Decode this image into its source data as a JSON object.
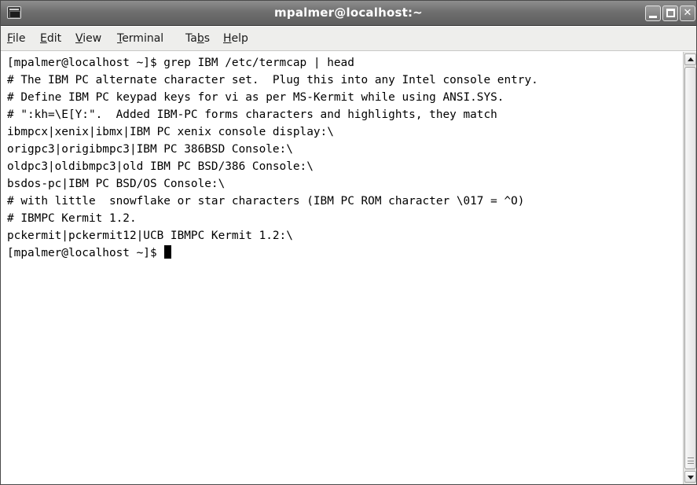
{
  "window": {
    "title": "mpalmer@localhost:~"
  },
  "menu": [
    {
      "mnemonic": "F",
      "rest": "ile"
    },
    {
      "mnemonic": "E",
      "rest": "dit"
    },
    {
      "mnemonic": "V",
      "rest": "iew"
    },
    {
      "mnemonic": "T",
      "rest": "erminal"
    },
    {
      "pre": "Ta",
      "mnemonic": "b",
      "rest": "s"
    },
    {
      "mnemonic": "H",
      "rest": "elp"
    }
  ],
  "terminal": {
    "lines": [
      "[mpalmer@localhost ~]$ grep IBM /etc/termcap | head",
      "# The IBM PC alternate character set.  Plug this into any Intel console entry.",
      "# Define IBM PC keypad keys for vi as per MS-Kermit while using ANSI.SYS.",
      "# \":kh=\\E[Y:\".  Added IBM-PC forms characters and highlights, they match",
      "ibmpcx|xenix|ibmx|IBM PC xenix console display:\\",
      "origpc3|origibmpc3|IBM PC 386BSD Console:\\",
      "oldpc3|oldibmpc3|old IBM PC BSD/386 Console:\\",
      "bsdos-pc|IBM PC BSD/OS Console:\\",
      "# with little  snowflake or star characters (IBM PC ROM character \\017 = ^O)",
      "# IBMPC Kermit 1.2.",
      "pckermit|pckermit12|UCB IBMPC Kermit 1.2:\\"
    ],
    "prompt": "[mpalmer@localhost ~]$ "
  },
  "icons": {
    "window_icon": "terminal-app-icon",
    "minimize": "minimize-icon",
    "maximize": "maximize-icon",
    "close": "close-icon"
  }
}
